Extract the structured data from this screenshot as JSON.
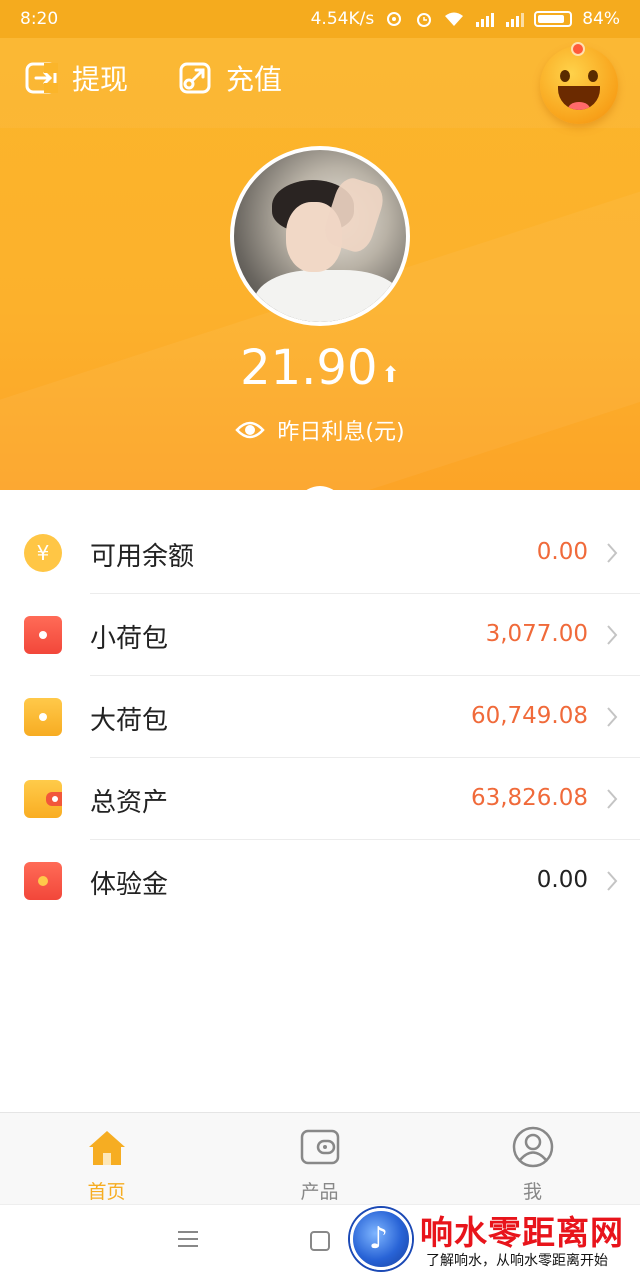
{
  "status_bar": {
    "time": "8:20",
    "speed": "4.54K/s",
    "battery": "84%"
  },
  "header": {
    "withdraw_label": "提现",
    "recharge_label": "充值",
    "interest_value": "21.90",
    "interest_label": "昨日利息(元)"
  },
  "accounts": [
    {
      "label": "可用余额",
      "value": "0.00",
      "icon": "yuan-coin-icon"
    },
    {
      "label": "小荷包",
      "value": "3,077.00",
      "icon": "small-purse-icon"
    },
    {
      "label": "大荷包",
      "value": "60,749.08",
      "icon": "big-purse-icon"
    },
    {
      "label": "总资产",
      "value": "63,826.08",
      "icon": "wallet-icon"
    },
    {
      "label": "体验金",
      "value": "0.00",
      "icon": "trial-fund-icon"
    }
  ],
  "tabs": [
    {
      "label": "首页",
      "icon": "home-icon",
      "active": true
    },
    {
      "label": "产品",
      "icon": "product-wallet-icon",
      "active": false
    },
    {
      "label": "我",
      "icon": "profile-icon",
      "active": false
    }
  ],
  "watermark": {
    "title": "响水零距离网",
    "subtitle": "了解响水，从响水零距离开始"
  },
  "colors": {
    "brand": "#fcb12c",
    "accent_value": "#f06a3a",
    "tab_active": "#f6ad22"
  }
}
